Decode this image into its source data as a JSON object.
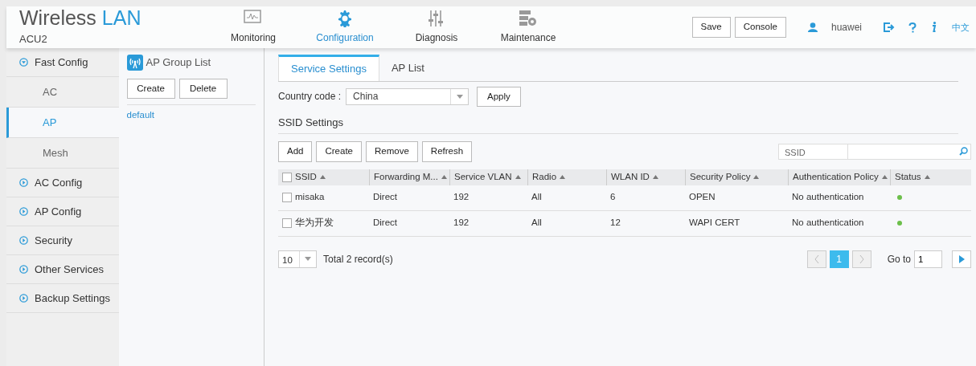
{
  "brand": {
    "title": "Wireless",
    "title_accent": "LAN",
    "device": "ACU2"
  },
  "nav": [
    {
      "label": "Monitoring",
      "selected": false
    },
    {
      "label": "Configuration",
      "selected": true
    },
    {
      "label": "Diagnosis",
      "selected": false
    },
    {
      "label": "Maintenance",
      "selected": false
    }
  ],
  "header_buttons": [
    "Save",
    "Console"
  ],
  "user": "huawei",
  "language": "中文",
  "sidebar": [
    {
      "label": "Fast Config",
      "expanded": true,
      "children": [
        {
          "label": "AC",
          "selected": false
        },
        {
          "label": "AP",
          "selected": true
        },
        {
          "label": "Mesh",
          "selected": false
        }
      ]
    },
    {
      "label": "AC Config",
      "expanded": false
    },
    {
      "label": "AP Config",
      "expanded": false
    },
    {
      "label": "Security",
      "expanded": false
    },
    {
      "label": "Other Services",
      "expanded": false
    },
    {
      "label": "Backup Settings",
      "expanded": false
    }
  ],
  "group_panel": {
    "title": "AP Group List",
    "buttons": [
      "Create",
      "Delete"
    ],
    "items": [
      {
        "label": "default",
        "selected": false
      }
    ]
  },
  "tabs": [
    {
      "label": "Service Settings",
      "selected": true
    },
    {
      "label": "AP List",
      "selected": false
    }
  ],
  "country": {
    "label": "Country code :",
    "value": "China",
    "button": "Apply"
  },
  "section_title": "SSID Settings",
  "toolbar": [
    "Add",
    "Create",
    "Remove",
    "Refresh"
  ],
  "search": {
    "label": "SSID"
  },
  "table": {
    "select_all": false,
    "columns": [
      "SSID",
      "Forwarding M...",
      "Service VLAN",
      "Radio",
      "WLAN ID",
      "Security Policy",
      "Authentication Policy",
      "Status"
    ],
    "rows": [
      {
        "checked": false,
        "cells": [
          "misaka",
          "Direct",
          "192",
          "All",
          "6",
          "OPEN",
          "No authentication"
        ],
        "color": "#6cbf4a"
      },
      {
        "checked": false,
        "cells": [
          "华为开发",
          "Direct",
          "192",
          "All",
          "12",
          "WAPI CERT",
          "No authentication"
        ],
        "color": "#6cbf4a"
      }
    ]
  },
  "pagination": {
    "page_size": "10",
    "total": "Total 2 record(s)",
    "pages": [
      {
        "label": "1",
        "selected": true
      }
    ],
    "goto_label": "Go to",
    "goto_value": "1"
  }
}
